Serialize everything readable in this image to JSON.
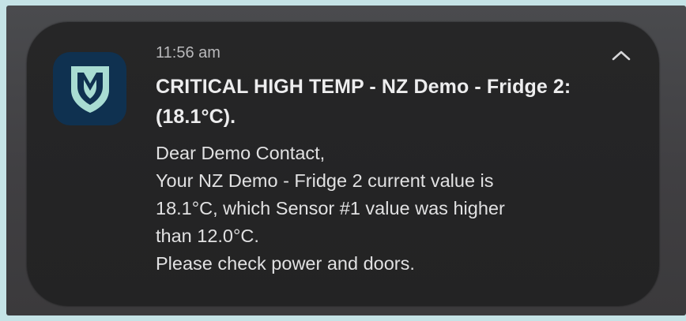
{
  "notification": {
    "time": "11:56 am",
    "title": "CRITICAL HIGH TEMP - NZ Demo - Fridge 2: (18.1°C).",
    "body_lines": [
      "Dear Demo Contact,",
      "Your NZ Demo - Fridge 2 current value is",
      "18.1°C, which Sensor #1 value was higher",
      "than 12.0°C.",
      "Please check power and doors."
    ],
    "app_icon": "shield-m-logo-icon",
    "collapse_icon": "chevron-up-icon"
  },
  "colors": {
    "page_background": "#c5e3e6",
    "card_background": "#262627",
    "icon_background": "#0f3150",
    "icon_foreground": "#a8dcd2",
    "title_text": "#ededee",
    "body_text": "#e1e1e2",
    "time_text": "#b9b9bb"
  }
}
